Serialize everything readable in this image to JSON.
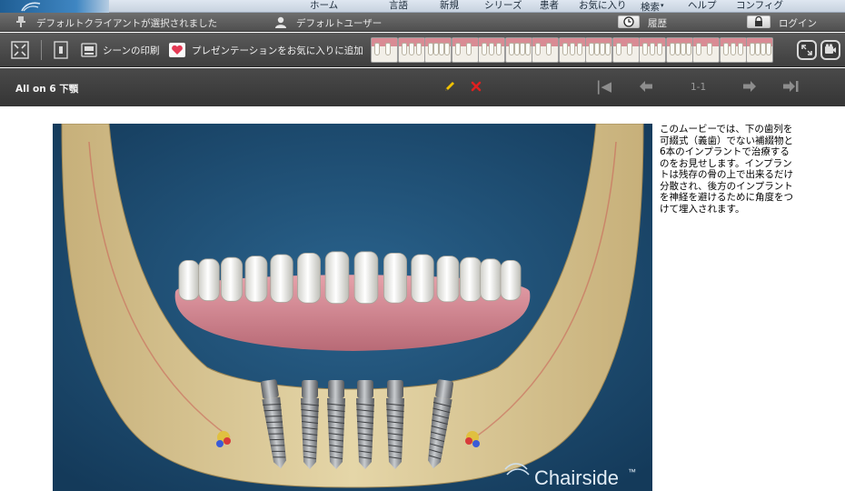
{
  "menu": {
    "items": [
      {
        "label": "ホーム",
        "has_dropdown": false
      },
      {
        "label": "言語",
        "has_dropdown": false
      },
      {
        "label": "新規",
        "has_dropdown": false
      },
      {
        "label": "シリーズ",
        "has_dropdown": false
      },
      {
        "label": "患者",
        "has_dropdown": false
      },
      {
        "label": "お気に入り",
        "has_dropdown": false
      },
      {
        "label": "検索",
        "has_dropdown": true
      },
      {
        "label": "ヘルプ",
        "has_dropdown": false
      },
      {
        "label": "コンフィグ",
        "has_dropdown": false
      }
    ]
  },
  "status": {
    "client": "デフォルトクライアントが選択されました",
    "user": "デフォルトユーザー",
    "history": "履歴",
    "login": "ログイン"
  },
  "toolbar": {
    "print_label": "シーンの印刷",
    "add_favorite_label": "プレゼンテーションをお気に入りに追加",
    "thumbnail_count": 15
  },
  "nav": {
    "title": "All on 6 下顎",
    "page": "1-1"
  },
  "scene": {
    "watermark": "Chairside",
    "trademark": "™"
  },
  "description": "このムービーでは、下の歯列を可綴式（義歯）でない補綴物と6本のインプラントで治療するのをお見せします。インプラントは残存の骨の上で出来るだけ分散され、後方のインプラントを神経を避けるために角度をつけて埋入されます。",
  "colors": {
    "scene_bg": "#1d4d73",
    "bone": "#d8c79a",
    "gum": "#d98b94",
    "delete_icon": "#e02020",
    "favorite_icon": "#e53a55"
  }
}
